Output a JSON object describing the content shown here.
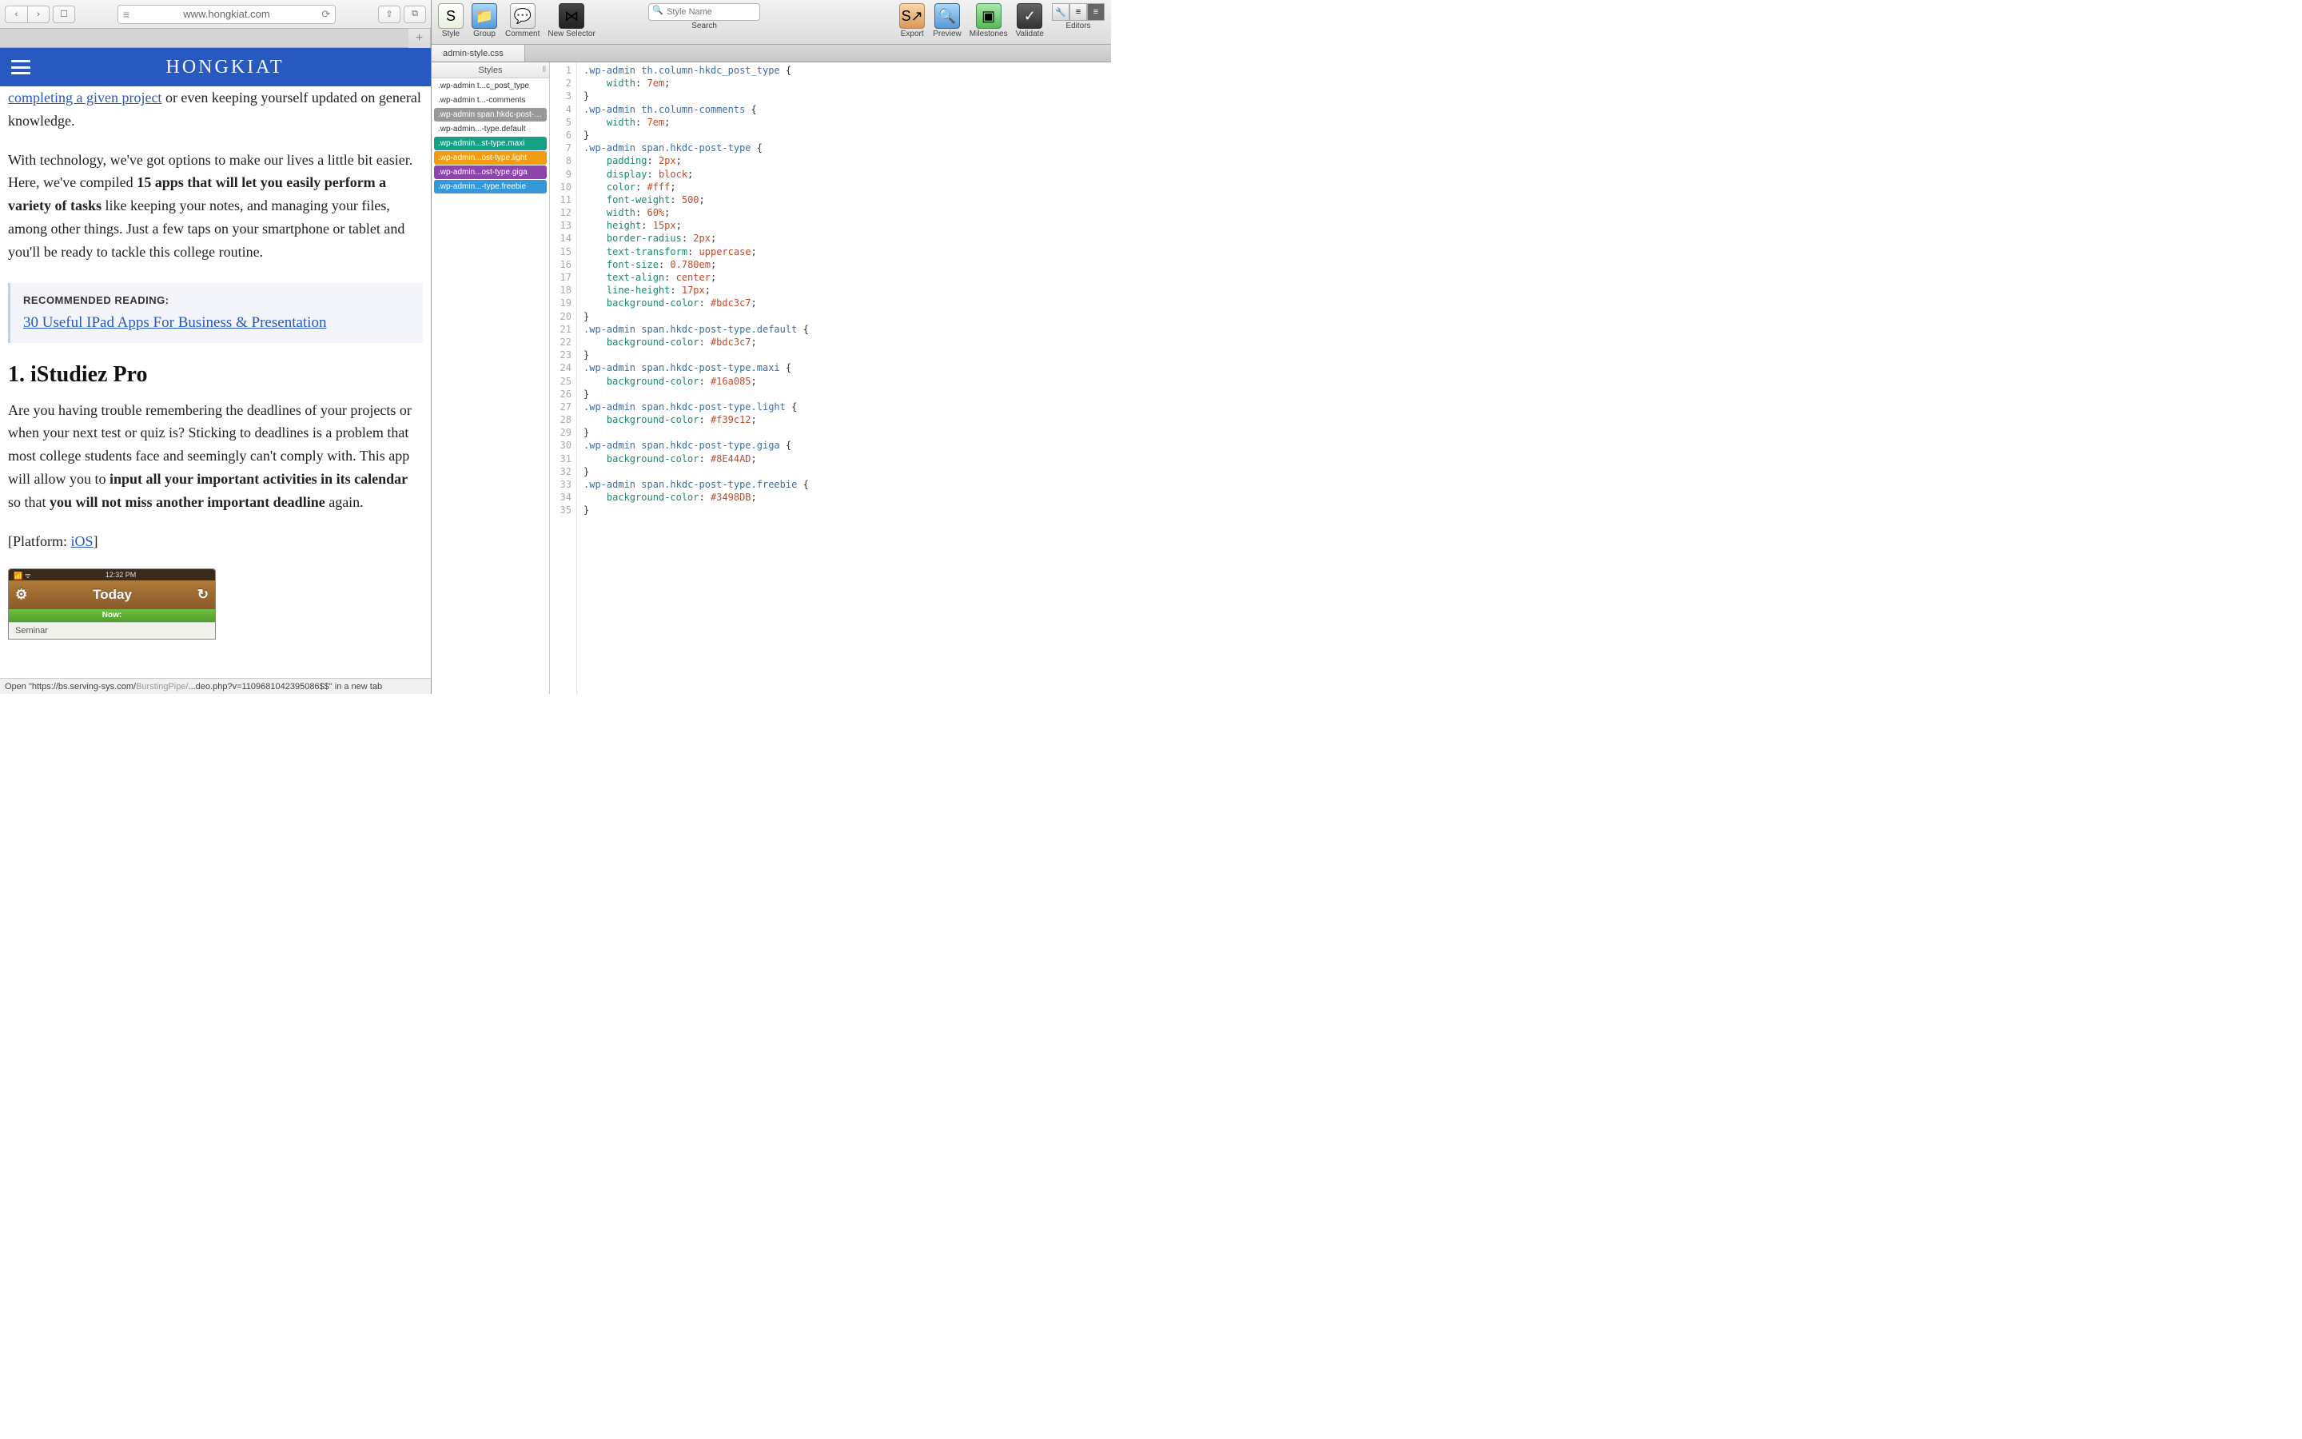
{
  "safari": {
    "url": "www.hongkiat.com",
    "status_prefix": "Open \"https://bs.serving-sys.com/",
    "status_mid": "BurstingPipe/",
    "status_suffix": "...deo.php?v=1109681042395086$$\" in a new tab"
  },
  "hongkiat": {
    "logo": "HONGKIAT",
    "para1_link": "completing a given project",
    "para1_rest": " or even keeping yourself updated on general knowledge.",
    "para2_a": "With technology, we've got options to make our lives a little bit easier. Here, we've compiled ",
    "para2_b": "15 apps that will let you easily perform a variety of tasks",
    "para2_c": " like keeping your notes, and managing your files, among other things. Just a few taps on your smartphone or tablet and you'll be ready to tackle this college routine.",
    "reco_title": "RECOMMENDED READING:",
    "reco_link": "30 Useful IPad Apps For Business & Presentation",
    "h2": "1. iStudiez Pro",
    "para3_a": "Are you having trouble remembering the deadlines of your projects or when your next test or quiz is? Sticking to deadlines is a problem that most college students face and seemingly can't comply with. This app will allow you to ",
    "para3_b": "input all your important activities in its calendar",
    "para3_c": " so that ",
    "para3_d": "you will not miss another important deadline",
    "para3_e": " again.",
    "platform_label": "[Platform: ",
    "platform_link": "iOS",
    "platform_close": "]",
    "istudiez_time": "12:32 PM",
    "istudiez_today": "Today",
    "istudiez_now": "Now:",
    "istudiez_seminar": "Seminar"
  },
  "editor": {
    "toolbar": {
      "style": "Style",
      "group": "Group",
      "comment": "Comment",
      "newsel": "New Selector",
      "search_placeholder": "Style Name",
      "search_label": "Search",
      "export": "Export",
      "preview": "Preview",
      "milestones": "Milestones",
      "validate": "Validate",
      "editors": "Editors"
    },
    "file_tab": "admin-style.css",
    "sidebar_header": "Styles",
    "styles": [
      {
        "label": ".wp-admin t...c_post_type",
        "class": "plain"
      },
      {
        "label": ".wp-admin t...-comments",
        "class": "plain"
      },
      {
        "label": ".wp-admin span.hkdc-post-type",
        "class": "sel"
      },
      {
        "label": ".wp-admin...-type.default",
        "class": "plain"
      },
      {
        "label": ".wp-admin...st-type.maxi",
        "class": "tag",
        "bg": "#16a085"
      },
      {
        "label": ".wp-admin...ost-type.light",
        "class": "tag",
        "bg": "#f39c12"
      },
      {
        "label": ".wp-admin...ost-type.giga",
        "class": "tag",
        "bg": "#8E44AD"
      },
      {
        "label": ".wp-admin...-type.freebie",
        "class": "tag",
        "bg": "#3498DB"
      }
    ],
    "code": [
      [
        {
          "t": ".wp-admin",
          "c": "tok-sel"
        },
        {
          "t": " ",
          "c": ""
        },
        {
          "t": "th.column-hkdc_post_type",
          "c": "tok-class"
        },
        {
          "t": " {",
          "c": "tok-brace"
        }
      ],
      [
        {
          "t": "    ",
          "c": ""
        },
        {
          "t": "width",
          "c": "tok-prop"
        },
        {
          "t": ": ",
          "c": "tok-punc"
        },
        {
          "t": "7em",
          "c": "tok-val"
        },
        {
          "t": ";",
          "c": "tok-punc"
        }
      ],
      [
        {
          "t": "}",
          "c": "tok-brace"
        }
      ],
      [
        {
          "t": ".wp-admin",
          "c": "tok-sel"
        },
        {
          "t": " ",
          "c": ""
        },
        {
          "t": "th.column-comments",
          "c": "tok-class"
        },
        {
          "t": " {",
          "c": "tok-brace"
        }
      ],
      [
        {
          "t": "    ",
          "c": ""
        },
        {
          "t": "width",
          "c": "tok-prop"
        },
        {
          "t": ": ",
          "c": "tok-punc"
        },
        {
          "t": "7em",
          "c": "tok-val"
        },
        {
          "t": ";",
          "c": "tok-punc"
        }
      ],
      [
        {
          "t": "}",
          "c": "tok-brace"
        }
      ],
      [
        {
          "t": ".wp-admin",
          "c": "tok-sel"
        },
        {
          "t": " ",
          "c": ""
        },
        {
          "t": "span.hkdc-post-type",
          "c": "tok-class"
        },
        {
          "t": " {",
          "c": "tok-brace"
        }
      ],
      [
        {
          "t": "    ",
          "c": ""
        },
        {
          "t": "padding",
          "c": "tok-prop"
        },
        {
          "t": ": ",
          "c": "tok-punc"
        },
        {
          "t": "2px",
          "c": "tok-val"
        },
        {
          "t": ";",
          "c": "tok-punc"
        }
      ],
      [
        {
          "t": "    ",
          "c": ""
        },
        {
          "t": "display",
          "c": "tok-prop"
        },
        {
          "t": ": ",
          "c": "tok-punc"
        },
        {
          "t": "block",
          "c": "tok-val"
        },
        {
          "t": ";",
          "c": "tok-punc"
        }
      ],
      [
        {
          "t": "    ",
          "c": ""
        },
        {
          "t": "color",
          "c": "tok-prop"
        },
        {
          "t": ": ",
          "c": "tok-punc"
        },
        {
          "t": "#fff",
          "c": "tok-val"
        },
        {
          "t": ";",
          "c": "tok-punc"
        }
      ],
      [
        {
          "t": "    ",
          "c": ""
        },
        {
          "t": "font-weight",
          "c": "tok-prop"
        },
        {
          "t": ": ",
          "c": "tok-punc"
        },
        {
          "t": "500",
          "c": "tok-val"
        },
        {
          "t": ";",
          "c": "tok-punc"
        }
      ],
      [
        {
          "t": "    ",
          "c": ""
        },
        {
          "t": "width",
          "c": "tok-prop"
        },
        {
          "t": ": ",
          "c": "tok-punc"
        },
        {
          "t": "60%",
          "c": "tok-val"
        },
        {
          "t": ";",
          "c": "tok-punc"
        }
      ],
      [
        {
          "t": "    ",
          "c": ""
        },
        {
          "t": "height",
          "c": "tok-prop"
        },
        {
          "t": ": ",
          "c": "tok-punc"
        },
        {
          "t": "15px",
          "c": "tok-val"
        },
        {
          "t": ";",
          "c": "tok-punc"
        }
      ],
      [
        {
          "t": "    ",
          "c": ""
        },
        {
          "t": "border-radius",
          "c": "tok-prop"
        },
        {
          "t": ": ",
          "c": "tok-punc"
        },
        {
          "t": "2px",
          "c": "tok-val"
        },
        {
          "t": ";",
          "c": "tok-punc"
        }
      ],
      [
        {
          "t": "    ",
          "c": ""
        },
        {
          "t": "text-transform",
          "c": "tok-prop"
        },
        {
          "t": ": ",
          "c": "tok-punc"
        },
        {
          "t": "uppercase",
          "c": "tok-val"
        },
        {
          "t": ";",
          "c": "tok-punc"
        }
      ],
      [
        {
          "t": "    ",
          "c": ""
        },
        {
          "t": "font-size",
          "c": "tok-prop"
        },
        {
          "t": ": ",
          "c": "tok-punc"
        },
        {
          "t": "0.780em",
          "c": "tok-val"
        },
        {
          "t": ";",
          "c": "tok-punc"
        }
      ],
      [
        {
          "t": "    ",
          "c": ""
        },
        {
          "t": "text-align",
          "c": "tok-prop"
        },
        {
          "t": ": ",
          "c": "tok-punc"
        },
        {
          "t": "center",
          "c": "tok-val"
        },
        {
          "t": ";",
          "c": "tok-punc"
        }
      ],
      [
        {
          "t": "    ",
          "c": ""
        },
        {
          "t": "line-height",
          "c": "tok-prop"
        },
        {
          "t": ": ",
          "c": "tok-punc"
        },
        {
          "t": "17px",
          "c": "tok-val"
        },
        {
          "t": ";",
          "c": "tok-punc"
        }
      ],
      [
        {
          "t": "    ",
          "c": ""
        },
        {
          "t": "background-color",
          "c": "tok-prop"
        },
        {
          "t": ": ",
          "c": "tok-punc"
        },
        {
          "t": "#bdc3c7",
          "c": "tok-val"
        },
        {
          "t": ";",
          "c": "tok-punc"
        }
      ],
      [
        {
          "t": "}",
          "c": "tok-brace"
        }
      ],
      [
        {
          "t": ".wp-admin",
          "c": "tok-sel"
        },
        {
          "t": " ",
          "c": ""
        },
        {
          "t": "span.hkdc-post-type.default",
          "c": "tok-class"
        },
        {
          "t": " {",
          "c": "tok-brace"
        }
      ],
      [
        {
          "t": "    ",
          "c": ""
        },
        {
          "t": "background-color",
          "c": "tok-prop"
        },
        {
          "t": ": ",
          "c": "tok-punc"
        },
        {
          "t": "#bdc3c7",
          "c": "tok-val"
        },
        {
          "t": ";",
          "c": "tok-punc"
        }
      ],
      [
        {
          "t": "}",
          "c": "tok-brace"
        }
      ],
      [
        {
          "t": ".wp-admin",
          "c": "tok-sel"
        },
        {
          "t": " ",
          "c": ""
        },
        {
          "t": "span.hkdc-post-type.maxi",
          "c": "tok-class"
        },
        {
          "t": " {",
          "c": "tok-brace"
        }
      ],
      [
        {
          "t": "    ",
          "c": ""
        },
        {
          "t": "background-color",
          "c": "tok-prop"
        },
        {
          "t": ": ",
          "c": "tok-punc"
        },
        {
          "t": "#16a085",
          "c": "tok-val"
        },
        {
          "t": ";",
          "c": "tok-punc"
        }
      ],
      [
        {
          "t": "}",
          "c": "tok-brace"
        }
      ],
      [
        {
          "t": ".wp-admin",
          "c": "tok-sel"
        },
        {
          "t": " ",
          "c": ""
        },
        {
          "t": "span.hkdc-post-type.light",
          "c": "tok-class"
        },
        {
          "t": " {",
          "c": "tok-brace"
        }
      ],
      [
        {
          "t": "    ",
          "c": ""
        },
        {
          "t": "background-color",
          "c": "tok-prop"
        },
        {
          "t": ": ",
          "c": "tok-punc"
        },
        {
          "t": "#f39c12",
          "c": "tok-val"
        },
        {
          "t": ";",
          "c": "tok-punc"
        }
      ],
      [
        {
          "t": "}",
          "c": "tok-brace"
        }
      ],
      [
        {
          "t": ".wp-admin",
          "c": "tok-sel"
        },
        {
          "t": " ",
          "c": ""
        },
        {
          "t": "span.hkdc-post-type.giga",
          "c": "tok-class"
        },
        {
          "t": " {",
          "c": "tok-brace"
        }
      ],
      [
        {
          "t": "    ",
          "c": ""
        },
        {
          "t": "background-color",
          "c": "tok-prop"
        },
        {
          "t": ": ",
          "c": "tok-punc"
        },
        {
          "t": "#8E44AD",
          "c": "tok-val"
        },
        {
          "t": ";",
          "c": "tok-punc"
        }
      ],
      [
        {
          "t": "}",
          "c": "tok-brace"
        }
      ],
      [
        {
          "t": ".wp-admin",
          "c": "tok-sel"
        },
        {
          "t": " ",
          "c": ""
        },
        {
          "t": "span.hkdc-post-type.freebie",
          "c": "tok-class"
        },
        {
          "t": " {",
          "c": "tok-brace"
        }
      ],
      [
        {
          "t": "    ",
          "c": ""
        },
        {
          "t": "background-color",
          "c": "tok-prop"
        },
        {
          "t": ": ",
          "c": "tok-punc"
        },
        {
          "t": "#3498DB",
          "c": "tok-val"
        },
        {
          "t": ";",
          "c": "tok-punc"
        }
      ],
      [
        {
          "t": "}",
          "c": "tok-brace"
        }
      ]
    ]
  }
}
